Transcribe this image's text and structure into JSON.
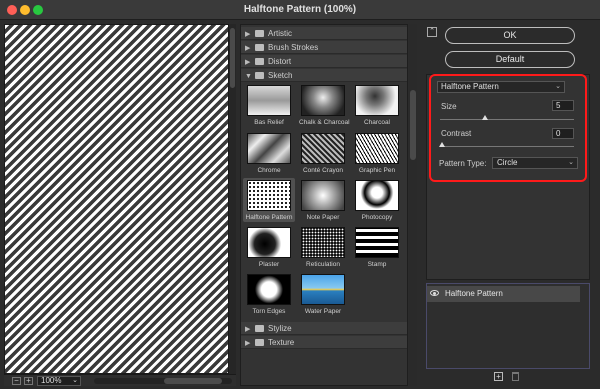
{
  "window": {
    "title": "Halftone Pattern (100%)"
  },
  "preview": {
    "zoom": "100%",
    "zoom_minus": "−",
    "zoom_plus": "+"
  },
  "gallery": {
    "categories": [
      {
        "name": "Artistic",
        "expanded": false
      },
      {
        "name": "Brush Strokes",
        "expanded": false
      },
      {
        "name": "Distort",
        "expanded": false
      },
      {
        "name": "Sketch",
        "expanded": true
      },
      {
        "name": "Stylize",
        "expanded": false
      },
      {
        "name": "Texture",
        "expanded": false
      }
    ],
    "sketch_filters": [
      {
        "label": "Bas Relief",
        "icon": "bas-relief-thumbnail"
      },
      {
        "label": "Chalk & Charcoal",
        "icon": "chalk-charcoal-thumbnail"
      },
      {
        "label": "Charcoal",
        "icon": "charcoal-thumbnail"
      },
      {
        "label": "Chrome",
        "icon": "chrome-thumbnail"
      },
      {
        "label": "Conté Crayon",
        "icon": "conte-crayon-thumbnail"
      },
      {
        "label": "Graphic Pen",
        "icon": "graphic-pen-thumbnail"
      },
      {
        "label": "Halftone Pattern",
        "icon": "halftone-pattern-thumbnail",
        "selected": true
      },
      {
        "label": "Note Paper",
        "icon": "note-paper-thumbnail"
      },
      {
        "label": "Photocopy",
        "icon": "photocopy-thumbnail"
      },
      {
        "label": "Plaster",
        "icon": "plaster-thumbnail"
      },
      {
        "label": "Reticulation",
        "icon": "reticulation-thumbnail"
      },
      {
        "label": "Stamp",
        "icon": "stamp-thumbnail"
      },
      {
        "label": "Torn Edges",
        "icon": "torn-edges-thumbnail"
      },
      {
        "label": "Water Paper",
        "icon": "water-paper-thumbnail"
      }
    ]
  },
  "buttons": {
    "ok": "OK",
    "default": "Default"
  },
  "settings": {
    "filter": "Halftone Pattern",
    "size_label": "Size",
    "size_value": "5",
    "size_fraction": 0.333,
    "contrast_label": "Contrast",
    "contrast_value": "0",
    "contrast_fraction": 0,
    "pattern_type_label": "Pattern Type:",
    "pattern_type_value": "Circle"
  },
  "layers": {
    "items": [
      {
        "name": "Halftone Pattern",
        "visible": true
      }
    ]
  },
  "colors": {
    "highlight": "#ff1a1a",
    "background": "#2b2b2b",
    "panel": "#333333"
  }
}
